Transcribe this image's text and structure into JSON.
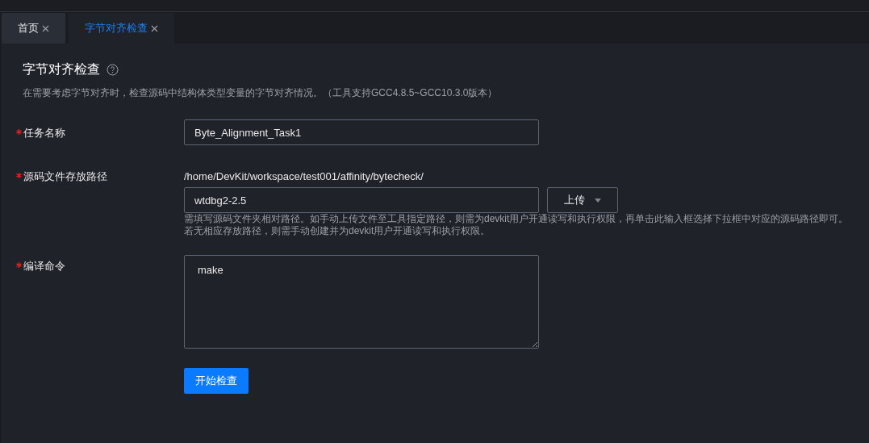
{
  "tabs": [
    {
      "label": "首页",
      "selected": false
    },
    {
      "label": "字节对齐检查",
      "selected": true
    }
  ],
  "page": {
    "title": "字节对齐检查",
    "description": "在需要考虑字节对齐时，检查源码中结构体类型变量的字节对齐情况。（工具支持GCC4.8.5~GCC10.3.0版本）"
  },
  "fields": [
    {
      "kind": "text",
      "label": "任务名称",
      "required": true,
      "value": "Byte_Alignment_Task1"
    },
    {
      "kind": "path",
      "label": "源码文件存放路径",
      "required": true,
      "prefix": "/home/DevKit/workspace/test001/affinity/bytecheck/",
      "value": "wtdbg2-2.5",
      "button": "上传",
      "hints": [
        "需填写源码文件夹相对路径。如手动上传文件至工具指定路径，则需为devkit用户开通读写和执行权限，再单击此输入框选择下拉框中对应的源码路径即可。",
        "若无相应存放路径，则需手动创建并为devkit用户开通读写和执行权限。"
      ]
    },
    {
      "kind": "textarea",
      "label": "编译命令",
      "required": true,
      "value": "make"
    }
  ],
  "submit": "开始检查"
}
